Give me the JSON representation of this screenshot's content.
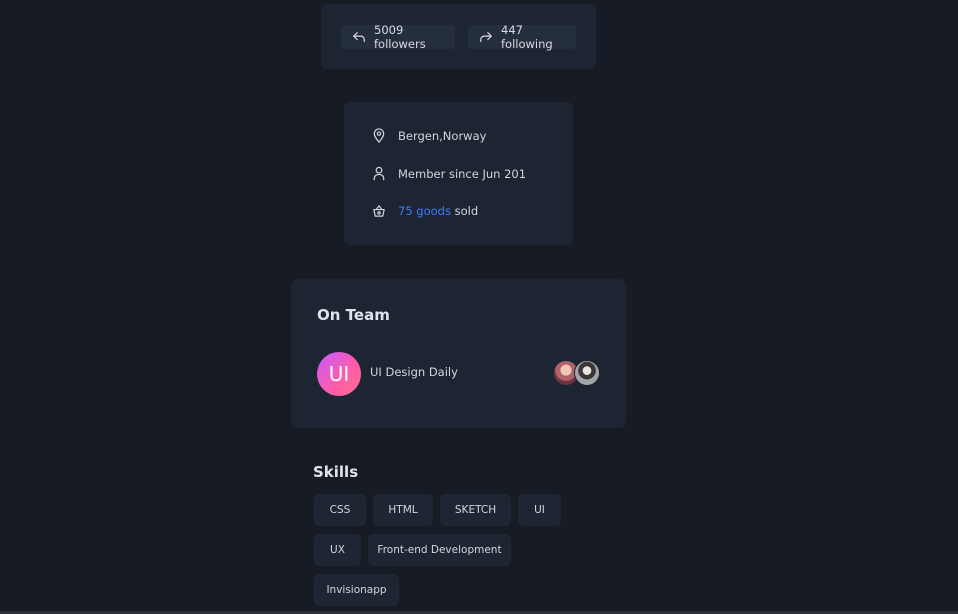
{
  "follow": {
    "followers_label": "5009 followers",
    "following_label": "447 following"
  },
  "info": {
    "location": "Bergen,Norway",
    "member_since": "Member since Jun 201",
    "goods_count": "75 goods",
    "goods_suffix": "sold"
  },
  "team": {
    "title": "On Team",
    "avatar_initials": "UI",
    "name": "UI Design Daily"
  },
  "skills": {
    "title": "Skills",
    "tags": [
      "CSS",
      "HTML",
      "SKETCH",
      "UI",
      "UX",
      "Front-end Development",
      "Invisionapp"
    ]
  },
  "colors": {
    "background": "#161b24",
    "card": "#1d2533",
    "accent": "#3d7bff"
  },
  "icons": {
    "followers": "reply-arrow-icon",
    "following": "share-arrow-icon",
    "location": "map-pin-icon",
    "member": "user-icon",
    "goods": "basket-icon"
  }
}
